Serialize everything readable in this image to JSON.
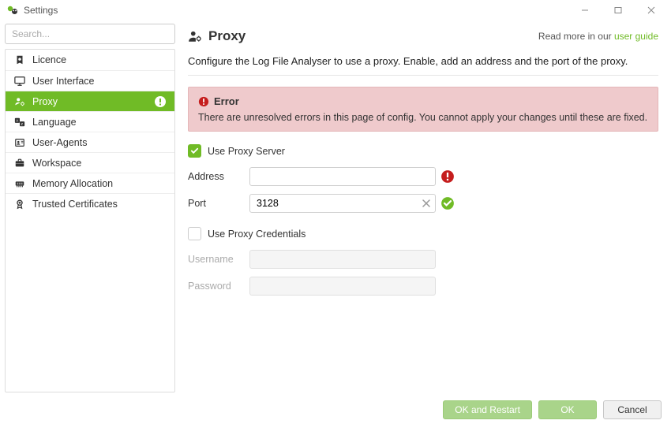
{
  "window": {
    "title": "Settings"
  },
  "search": {
    "placeholder": "Search..."
  },
  "sidebar": {
    "items": [
      {
        "label": "Licence",
        "icon": "licence"
      },
      {
        "label": "User Interface",
        "icon": "monitor"
      },
      {
        "label": "Proxy",
        "icon": "person-gear",
        "selected": true,
        "alert": true
      },
      {
        "label": "Language",
        "icon": "translate"
      },
      {
        "label": "User-Agents",
        "icon": "id-badge"
      },
      {
        "label": "Workspace",
        "icon": "briefcase"
      },
      {
        "label": "Memory Allocation",
        "icon": "memory"
      },
      {
        "label": "Trusted Certificates",
        "icon": "certificate"
      }
    ]
  },
  "page": {
    "title": "Proxy",
    "readmore_text": "Read more in our ",
    "readmore_link": "user guide",
    "description": "Configure the Log File Analyser to use a proxy. Enable, add an address and the port of the proxy.",
    "error": {
      "title": "Error",
      "body": "There are unresolved errors in this page of config. You cannot apply your changes until these are fixed."
    },
    "fields": {
      "use_proxy_label": "Use Proxy Server",
      "use_proxy_checked": true,
      "address_label": "Address",
      "address_value": "",
      "address_status": "error",
      "port_label": "Port",
      "port_value": "3128",
      "port_status": "ok",
      "use_credentials_label": "Use Proxy Credentials",
      "use_credentials_checked": false,
      "username_label": "Username",
      "username_value": "",
      "password_label": "Password",
      "password_value": ""
    }
  },
  "footer": {
    "ok_restart": "OK and Restart",
    "ok": "OK",
    "cancel": "Cancel"
  },
  "colors": {
    "accent": "#70bb26",
    "error_bg": "#efcacc",
    "error_icon": "#c51d1d"
  }
}
